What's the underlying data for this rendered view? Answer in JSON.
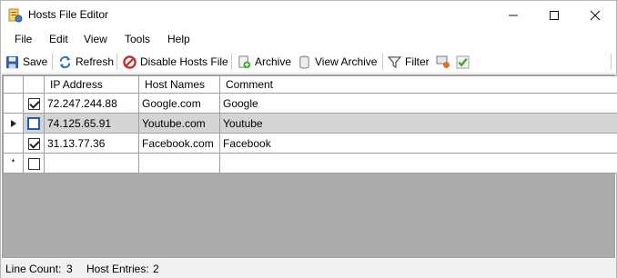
{
  "window": {
    "title": "Hosts File Editor",
    "controls": {
      "minimize": "—",
      "maximize": "☐",
      "close": "✕"
    }
  },
  "menu": {
    "items": [
      "File",
      "Edit",
      "View",
      "Tools",
      "Help"
    ]
  },
  "toolbar": {
    "save": "Save",
    "refresh": "Refresh",
    "disable_hosts": "Disable Hosts File",
    "archive": "Archive",
    "view_archive": "View Archive",
    "filter": "Filter",
    "colors": {
      "refresh": "#1f6fc2",
      "disable": "#d12a2a",
      "check": "#3aa12b"
    }
  },
  "grid": {
    "columns": [
      "IP Address",
      "Host Names",
      "Comment"
    ],
    "rows": [
      {
        "enabled": true,
        "ip": "72.247.244.88",
        "host": "Google.com",
        "comment": "Google",
        "current": false
      },
      {
        "enabled": false,
        "ip": "74.125.65.91",
        "host": "Youtube.com",
        "comment": "Youtube",
        "current": true
      },
      {
        "enabled": true,
        "ip": "31.13.77.36",
        "host": "Facebook.com",
        "comment": "Facebook",
        "current": false
      }
    ],
    "new_row_marker": "*"
  },
  "status": {
    "line_count_label": "Line Count:",
    "line_count": "3",
    "host_entries_label": "Host Entries:",
    "host_entries": "2"
  }
}
